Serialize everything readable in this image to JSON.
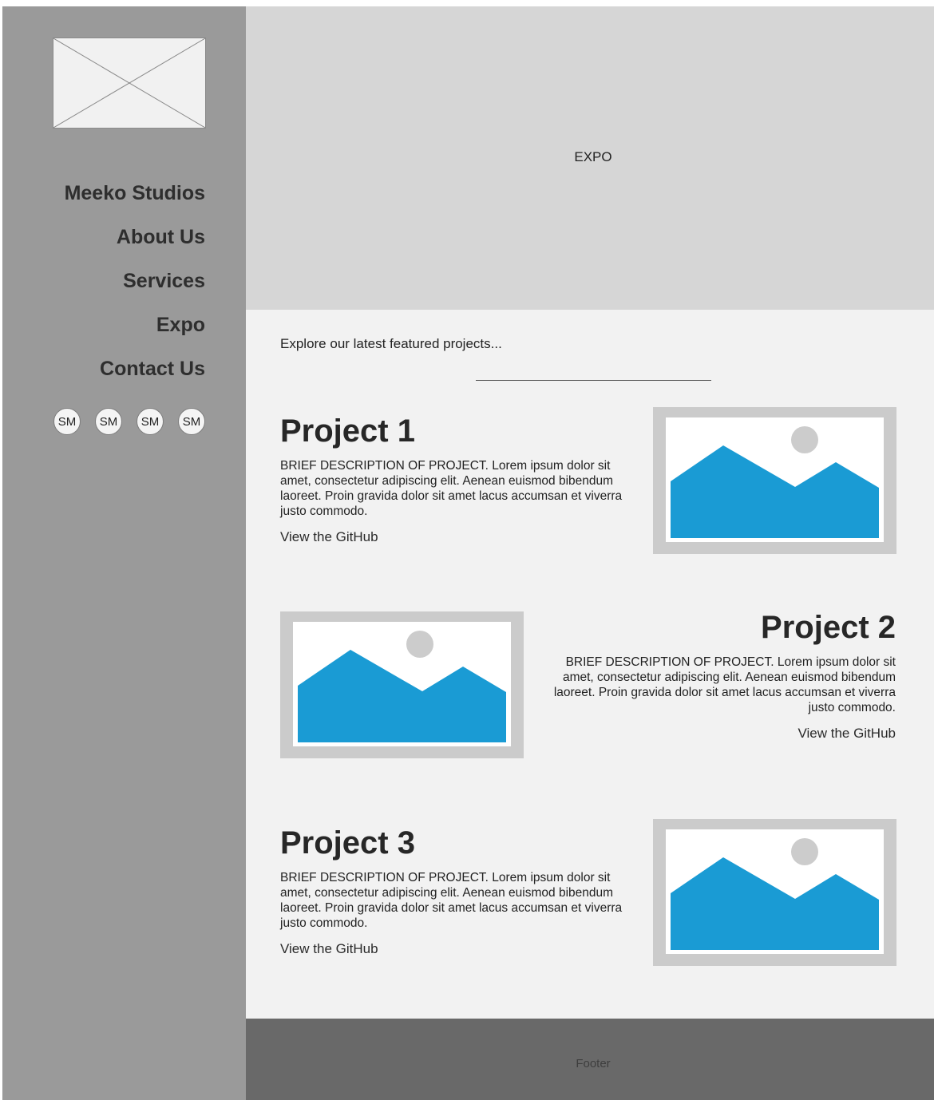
{
  "sidebar": {
    "logo_icon": "image-placeholder-icon",
    "nav": [
      {
        "label": "Meeko Studios"
      },
      {
        "label": "About Us"
      },
      {
        "label": "Services"
      },
      {
        "label": "Expo"
      },
      {
        "label": "Contact Us"
      }
    ],
    "social": [
      "SM",
      "SM",
      "SM",
      "SM"
    ]
  },
  "hero": {
    "label": "EXPO"
  },
  "main": {
    "intro": "Explore our latest featured projects...",
    "projects": [
      {
        "title": "Project 1",
        "description": "BRIEF DESCRIPTION OF PROJECT. Lorem ipsum dolor sit amet, consectetur adipiscing elit. Aenean euismod bibendum laoreet. Proin gravida dolor sit amet lacus accumsan et viverra justo commodo.",
        "link": "View the GitHub",
        "image_icon": "image-placeholder-icon"
      },
      {
        "title": "Project 2",
        "description": "BRIEF DESCRIPTION OF PROJECT. Lorem ipsum dolor sit amet, consectetur adipiscing elit. Aenean euismod bibendum laoreet. Proin gravida dolor sit amet lacus accumsan et viverra justo commodo.",
        "link": "View the GitHub",
        "image_icon": "image-placeholder-icon"
      },
      {
        "title": "Project 3",
        "description": "BRIEF DESCRIPTION OF PROJECT. Lorem ipsum dolor sit amet, consectetur adipiscing elit. Aenean euismod bibendum laoreet. Proin gravida dolor sit amet lacus accumsan et viverra justo commodo.",
        "link": "View the GitHub",
        "image_icon": "image-placeholder-icon"
      }
    ]
  },
  "footer": {
    "label": "Footer"
  },
  "colors": {
    "sidebar": "#9a9a9a",
    "hero": "#d6d6d6",
    "content": "#f2f2f2",
    "footer": "#696969",
    "mountain": "#1a9bd4",
    "sun": "#cccccc"
  }
}
